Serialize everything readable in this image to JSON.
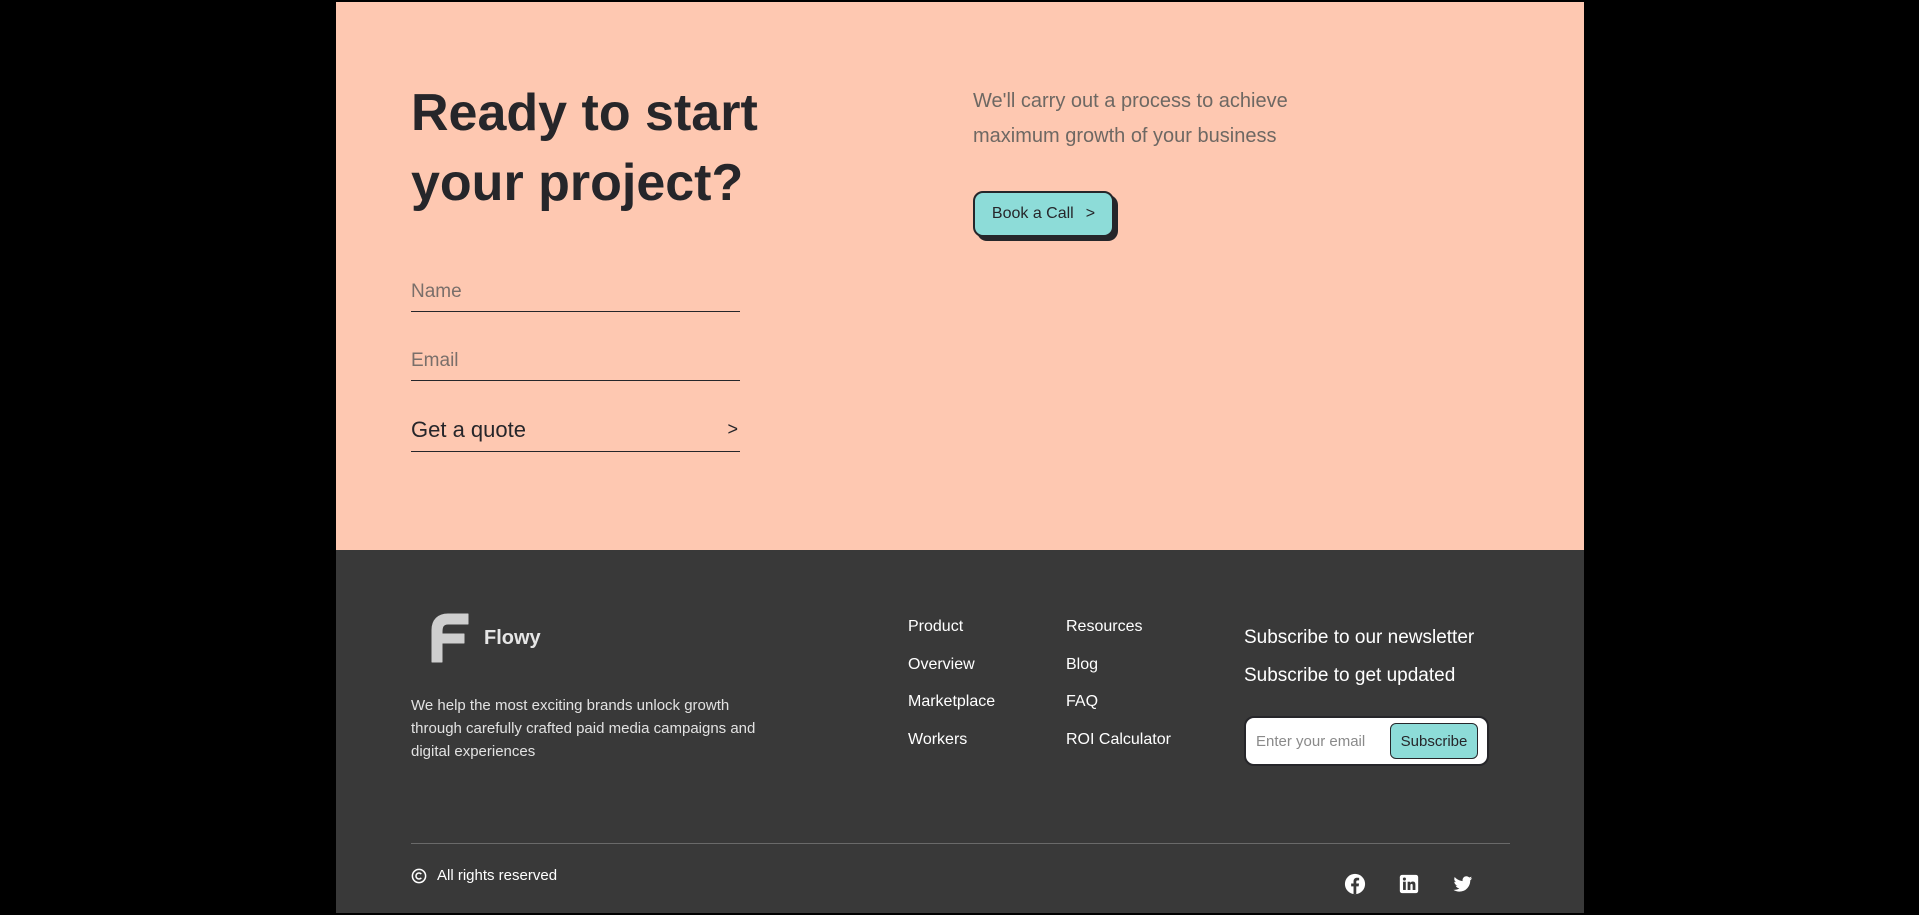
{
  "cta": {
    "title": "Ready to start your project?",
    "name_placeholder": "Name",
    "email_placeholder": "Email",
    "quote_label": "Get a quote",
    "quote_arrow": ">",
    "description": "We'll carry out a process to achieve maximum growth of your business",
    "book_label": "Book a Call",
    "book_arrow": ">"
  },
  "footer": {
    "brand": "Flowy",
    "tagline": "We help the most exciting brands unlock growth through carefully crafted paid media campaigns and digital experiences",
    "columns": [
      {
        "links": [
          "Product",
          "Overview",
          "Marketplace",
          "Workers"
        ]
      },
      {
        "links": [
          "Resources",
          "Blog",
          "FAQ",
          "ROI Calculator"
        ]
      }
    ],
    "newsletter": {
      "title": "Subscribe to our newsletter",
      "subtitle": "Subscribe to get updated",
      "placeholder": "Enter your email",
      "button": "Subscribe"
    },
    "copyright": "All rights reserved",
    "socials": [
      "facebook-icon",
      "linkedin-icon",
      "twitter-icon"
    ]
  },
  "colors": {
    "cta_bg": "#fec8b1",
    "footer_bg": "#393939",
    "accent": "#8ddcd8",
    "text_dark": "#26262a"
  }
}
